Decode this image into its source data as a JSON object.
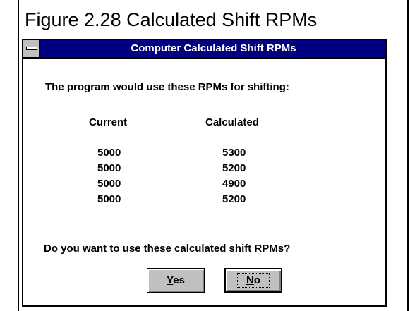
{
  "figure_caption": "Figure 2.28  Calculated Shift RPMs",
  "dialog": {
    "title": "Computer Calculated Shift RPMs",
    "prompt_top": "The program would use these RPMs for shifting:",
    "columns": {
      "current": "Current",
      "calculated": "Calculated"
    },
    "rows": [
      {
        "current": "5000",
        "calculated": "5300"
      },
      {
        "current": "5000",
        "calculated": "5200"
      },
      {
        "current": "5000",
        "calculated": "4900"
      },
      {
        "current": "5000",
        "calculated": "5200"
      }
    ],
    "prompt_bottom": "Do you want to use these calculated shift RPMs?",
    "buttons": {
      "yes": {
        "mnemonic": "Y",
        "rest": "es"
      },
      "no": {
        "mnemonic": "N",
        "rest": "o"
      }
    }
  },
  "colors": {
    "titlebar": "#000080",
    "button_face": "#c0c0c0"
  },
  "icons": {
    "system_menu": "system-menu-icon"
  }
}
